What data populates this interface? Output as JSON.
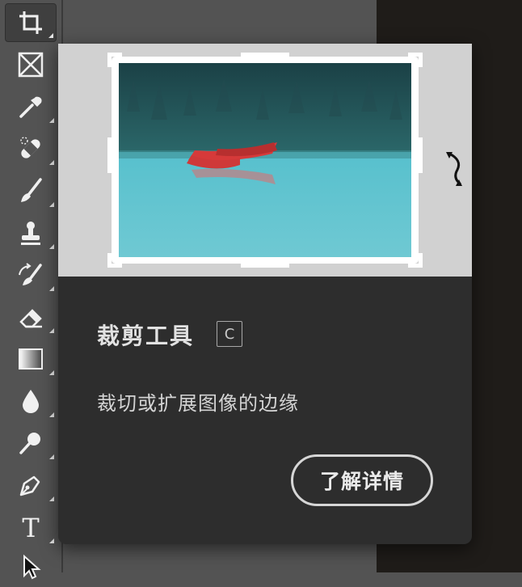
{
  "toolbar": {
    "tools": [
      {
        "name": "crop-tool",
        "icon": "crop-icon",
        "active": true
      },
      {
        "name": "frame-tool",
        "icon": "frame-icon"
      },
      {
        "name": "eyedropper-tool",
        "icon": "eyedropper-icon"
      },
      {
        "name": "healing-brush-tool",
        "icon": "bandage-icon"
      },
      {
        "name": "brush-tool",
        "icon": "brush-icon"
      },
      {
        "name": "clone-stamp-tool",
        "icon": "stamp-icon"
      },
      {
        "name": "history-brush-tool",
        "icon": "history-brush-icon"
      },
      {
        "name": "eraser-tool",
        "icon": "eraser-icon"
      },
      {
        "name": "gradient-tool",
        "icon": "gradient-icon"
      },
      {
        "name": "blur-tool",
        "icon": "water-drop-icon"
      },
      {
        "name": "dodge-tool",
        "icon": "dodge-icon"
      },
      {
        "name": "pen-tool",
        "icon": "pen-icon"
      },
      {
        "name": "type-tool",
        "icon": "type-icon",
        "glyph": "T"
      },
      {
        "name": "path-selection-tool",
        "icon": "arrow-cursor-icon"
      }
    ]
  },
  "tooltip": {
    "title": "裁剪工具",
    "shortcut": "C",
    "description": "裁切或扩展图像的边缘",
    "learn_more": "了解详情",
    "preview_icon": "rotate-icon"
  },
  "colors": {
    "toolbar_bg": "#535353",
    "popup_bg": "#2d2d2d",
    "preview_bg": "#d1d1d1",
    "canoe": "#d63a3a",
    "lake": "#5cc3cf",
    "forest": "#1f5257"
  }
}
